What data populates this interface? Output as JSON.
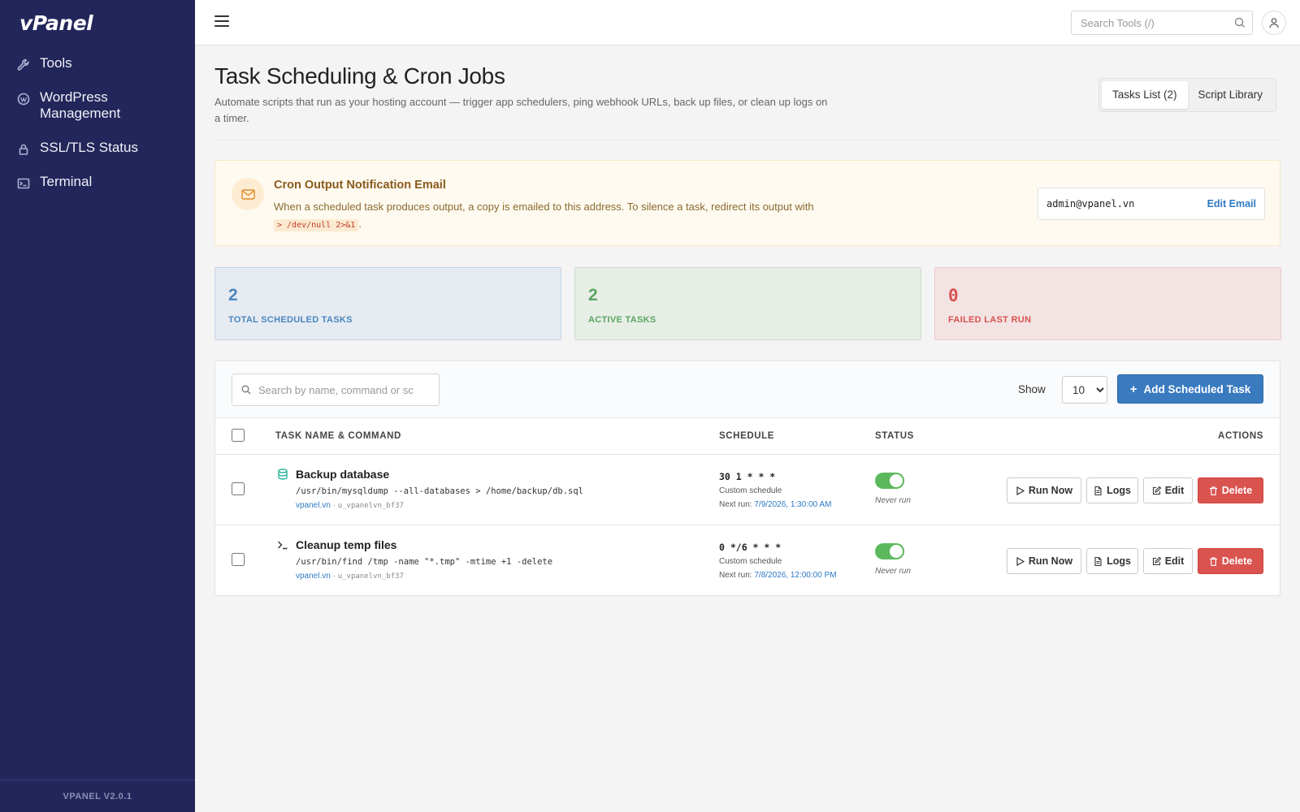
{
  "app": {
    "logo": "vPanel",
    "version": "VPANEL V2.0.1"
  },
  "sidebar": {
    "items": [
      {
        "label": "Tools",
        "icon": "wrench-icon"
      },
      {
        "label": "WordPress Management",
        "icon": "wordpress-icon"
      },
      {
        "label": "SSL/TLS Status",
        "icon": "lock-icon"
      },
      {
        "label": "Terminal",
        "icon": "terminal-icon"
      }
    ]
  },
  "topbar": {
    "search_placeholder": "Search Tools (/)"
  },
  "page": {
    "title": "Task Scheduling & Cron Jobs",
    "description": "Automate scripts that run as your hosting account — trigger app schedulers, ping webhook URLs, back up files, or clean up logs on a timer.",
    "tabs": [
      {
        "label": "Tasks List (2)",
        "active": true
      },
      {
        "label": "Script Library",
        "active": false
      }
    ]
  },
  "notice": {
    "title": "Cron Output Notification Email",
    "text": "When a scheduled task produces output, a copy is emailed to this address. To silence a task, redirect its output with",
    "code": "> /dev/null 2>&1",
    "suffix": ".",
    "email": "admin@vpanel.vn",
    "edit_label": "Edit Email"
  },
  "stats": [
    {
      "value": "2",
      "label": "TOTAL SCHEDULED TASKS",
      "color": "#4a86bd"
    },
    {
      "value": "2",
      "label": "ACTIVE TASKS",
      "color": "#5aa562"
    },
    {
      "value": "0",
      "label": "FAILED LAST RUN",
      "color": "#d9534f"
    }
  ],
  "table": {
    "search_placeholder": "Search by name, command or sc",
    "show_label": "Show",
    "show_value": "10",
    "add_label": "Add Scheduled Task",
    "headers": {
      "task": "TASK NAME & COMMAND",
      "schedule": "SCHEDULE",
      "status": "STATUS",
      "actions": "ACTIONS"
    },
    "rows": [
      {
        "icon": "database-icon",
        "name": "Backup database",
        "command": "/usr/bin/mysqldump --all-databases > /home/backup/db.sql",
        "domain": "vpanel.vn",
        "user": "u_vpanelvn_bf37",
        "schedule": "30 1 * * *",
        "schedule_type": "Custom schedule",
        "next_run_label": "Next run:",
        "next_run": "7/9/2026, 1:30:00 AM",
        "enabled": true,
        "last_run": "Never run"
      },
      {
        "icon": "terminal-icon",
        "name": "Cleanup temp files",
        "command": "/usr/bin/find /tmp -name \"*.tmp\" -mtime +1 -delete",
        "domain": "vpanel.vn",
        "user": "u_vpanelvn_bf37",
        "schedule": "0 */6 * * *",
        "schedule_type": "Custom schedule",
        "next_run_label": "Next run:",
        "next_run": "7/8/2026, 12:00:00 PM",
        "enabled": true,
        "last_run": "Never run"
      }
    ],
    "actions": {
      "run": "Run Now",
      "logs": "Logs",
      "edit": "Edit",
      "delete": "Delete"
    }
  },
  "colors": {
    "sidebar": "#23265a",
    "primary": "#3a7bc0",
    "success": "#5cb85c",
    "danger": "#d9534f"
  }
}
